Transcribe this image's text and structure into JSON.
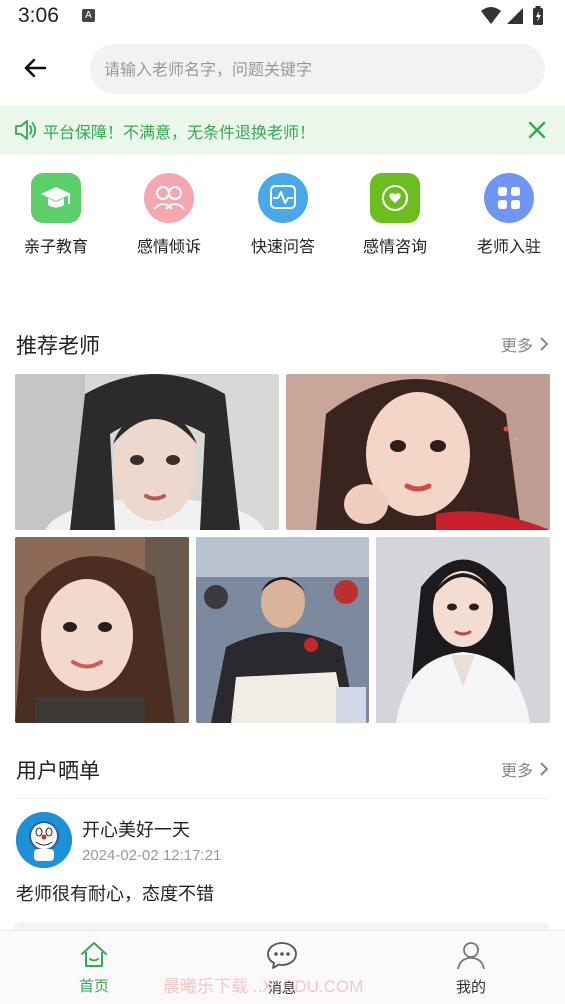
{
  "status_bar": {
    "time": "3:06",
    "notification_glyph": "A"
  },
  "search": {
    "placeholder": "请输入老师名字，问题关键字",
    "value": ""
  },
  "notice": {
    "text": "平台保障！不满意，无条件退换老师！",
    "color": "#34a853",
    "background": "#eaf7ea"
  },
  "categories": [
    {
      "label": "亲子教育",
      "icon": "graduation-cap-icon",
      "color": "#5ccf6a"
    },
    {
      "label": "感情倾诉",
      "icon": "couple-icon",
      "color": "#f4a7b0"
    },
    {
      "label": "快速问答",
      "icon": "pulse-chat-icon",
      "color": "#4aa8e8"
    },
    {
      "label": "感情咨询",
      "icon": "heart-chat-icon",
      "color": "#6cbd1f"
    },
    {
      "label": "老师入驻",
      "icon": "grid-icon",
      "color": "#6f96f3"
    }
  ],
  "recommended": {
    "title": "推荐老师",
    "more": "更多"
  },
  "reviews": {
    "title": "用户晒单",
    "more": "更多",
    "items": [
      {
        "name": "开心美好一天",
        "time": "2024-02-02 12:17:21",
        "content": "老师很有耐心，态度不错"
      }
    ]
  },
  "tabbar": {
    "tabs": [
      {
        "label": "首页",
        "icon": "home-icon",
        "active": true
      },
      {
        "label": "消息",
        "icon": "message-icon",
        "active": false
      },
      {
        "label": "我的",
        "icon": "profile-icon",
        "active": false
      }
    ],
    "active_color": "#34a853",
    "inactive_color": "#555555"
  },
  "watermark": "晨曦乐下载 ..XLEDU.COM"
}
